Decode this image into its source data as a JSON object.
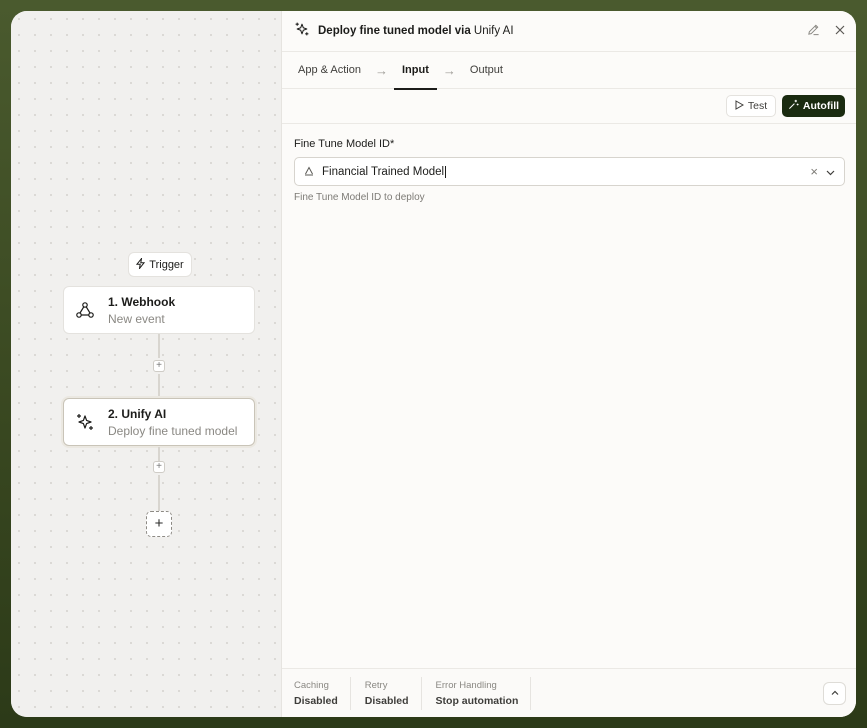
{
  "canvas": {
    "trigger_chip": {
      "label": "Trigger",
      "icon": "bolt-icon"
    },
    "nodes": [
      {
        "title": "1. Webhook",
        "subtitle": "New event",
        "icon": "webhook-icon"
      },
      {
        "title": "2. Unify AI",
        "subtitle": "Deploy fine tuned model",
        "icon": "sparkles-icon"
      }
    ],
    "connector_plus": "+",
    "add_step": "+"
  },
  "panel": {
    "header": {
      "title_prefix": "Deploy fine tuned model via",
      "title_app": "Unify AI",
      "icon": "sparkles-icon"
    },
    "tabs": [
      {
        "label": "App & Action",
        "active": false
      },
      {
        "label": "Input",
        "active": true
      },
      {
        "label": "Output",
        "active": false
      }
    ],
    "tab_arrow": "→",
    "toolbar": {
      "test_label": "Test",
      "autofill_label": "Autofill"
    },
    "field": {
      "label": "Fine Tune Model ID*",
      "value": "Financial Trained Model",
      "help": "Fine Tune Model ID to deploy",
      "clear": "×"
    },
    "footer": [
      {
        "key": "Caching",
        "value": "Disabled"
      },
      {
        "key": "Retry",
        "value": "Disabled"
      },
      {
        "key": "Error Handling",
        "value": "Stop automation"
      }
    ]
  },
  "colors": {
    "accent_dark": "#1a2b10",
    "background_outer": "#3b4a22"
  }
}
